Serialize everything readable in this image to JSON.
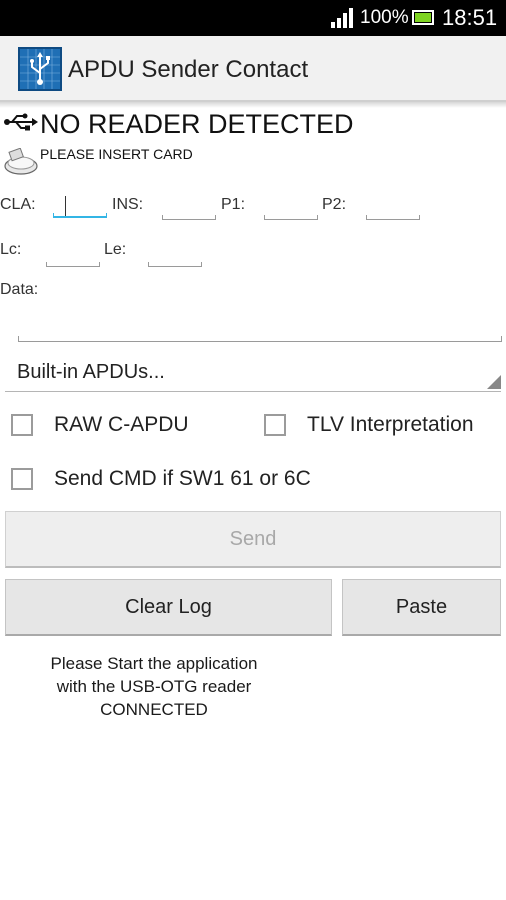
{
  "status_bar": {
    "battery_percent": "100%",
    "time": "18:51",
    "signal_icon": "signal-bars-icon",
    "battery_icon": "battery-icon",
    "battery_color": "#7ed321"
  },
  "action_bar": {
    "title": "APDU Sender Contact",
    "icon": "usb-app-icon",
    "icon_color": "#1f6fb5"
  },
  "reader": {
    "status": "NO READER DETECTED",
    "icon": "usb-icon"
  },
  "card": {
    "status": "PLEASE INSERT CARD",
    "icon": "smartcard-reader-icon"
  },
  "fields": {
    "cla": {
      "label": "CLA:",
      "value": ""
    },
    "ins": {
      "label": "INS:",
      "value": ""
    },
    "p1": {
      "label": "P1:",
      "value": ""
    },
    "p2": {
      "label": "P2:",
      "value": ""
    },
    "lc": {
      "label": "Lc:",
      "value": ""
    },
    "le": {
      "label": "Le:",
      "value": ""
    },
    "data": {
      "label": "Data:",
      "value": ""
    }
  },
  "builtin_spinner": {
    "selected": "Built-in APDUs..."
  },
  "options": {
    "raw_capdu": {
      "label": "RAW C-APDU",
      "checked": false
    },
    "tlv": {
      "label": "TLV Interpretation",
      "checked": false
    },
    "send_cmd": {
      "label": "Send CMD if SW1 61 or 6C",
      "checked": false
    }
  },
  "buttons": {
    "send": "Send",
    "clear_log": "Clear Log",
    "paste": "Paste"
  },
  "message": {
    "line1": "Please Start the application",
    "line2": "with the USB-OTG reader",
    "line3": "CONNECTED"
  },
  "accent_color": "#33b5e5"
}
